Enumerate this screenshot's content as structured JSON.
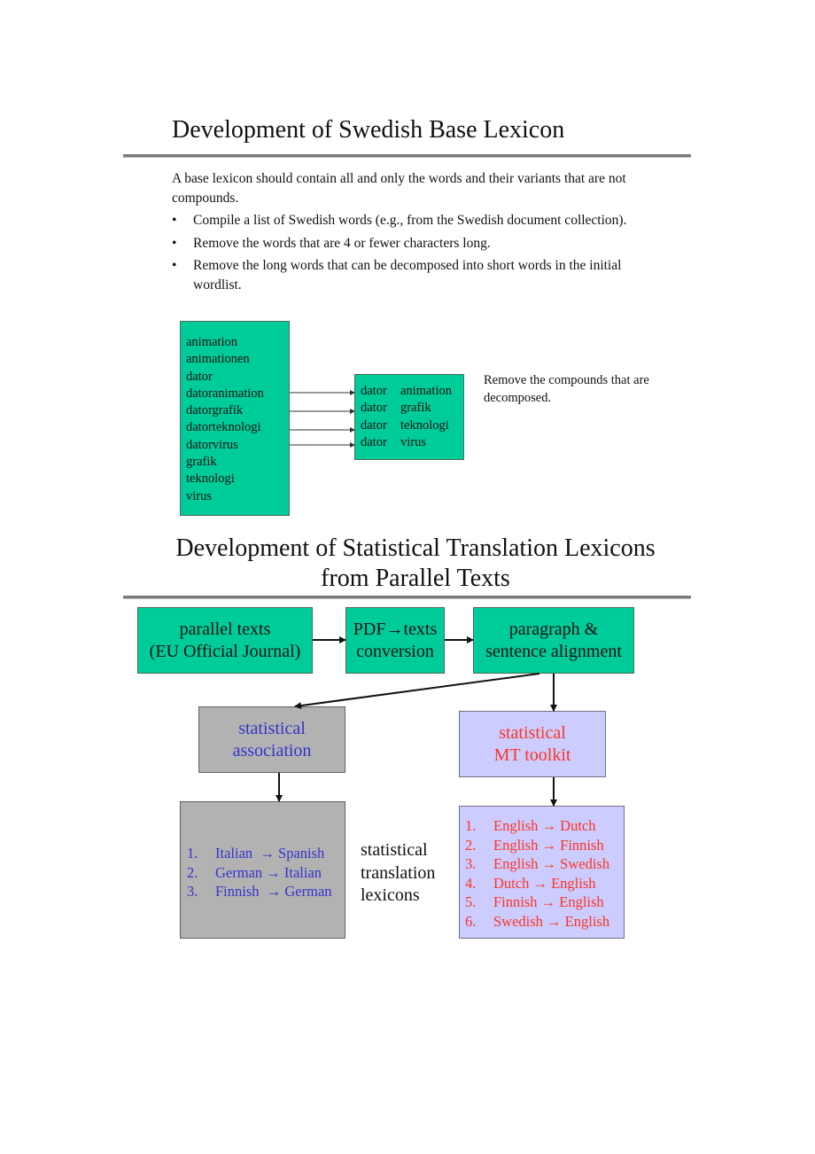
{
  "section1": {
    "title": "Development of Swedish Base Lexicon",
    "intro": "A base lexicon should contain all and only the words and their variants that are not compounds.",
    "bullet_glyph": "•",
    "bullets": [
      "Compile a list of Swedish words (e.g., from the Swedish document collection).",
      "Remove the words that are 4 or fewer characters long.",
      "Remove the long words that can be decomposed into short words in the initial wordlist."
    ],
    "wordlist": [
      "animation",
      "animationen",
      "dator",
      "datoranimation",
      "datorgrafik",
      "datorteknologi",
      "datorvirus",
      "grafik",
      "teknologi",
      "virus"
    ],
    "decomposed": [
      {
        "first": "dator",
        "second": "animation"
      },
      {
        "first": "dator",
        "second": "grafik"
      },
      {
        "first": "dator",
        "second": "teknologi"
      },
      {
        "first": "dator",
        "second": "virus"
      }
    ],
    "note": "Remove the compounds that are decomposed."
  },
  "section2": {
    "title_line1": "Development of Statistical Translation Lexicons",
    "title_line2": "from Parallel Texts",
    "pipeline": [
      {
        "line1": "parallel texts",
        "line2": "(EU Official Journal)"
      },
      {
        "line1": "PDF→texts",
        "line2": "conversion"
      },
      {
        "line1": "paragraph &",
        "line2": "sentence alignment"
      }
    ],
    "association": {
      "line1": "statistical",
      "line2": "association"
    },
    "toolkit": {
      "line1": "statistical",
      "line2": "MT toolkit"
    },
    "association_pairs": [
      {
        "num": "1.",
        "pair": "Italian  → Spanish"
      },
      {
        "num": "2.",
        "pair": "German → Italian"
      },
      {
        "num": "3.",
        "pair": "Finnish  → German"
      }
    ],
    "toolkit_pairs": [
      {
        "num": "1.",
        "pair": "English → Dutch"
      },
      {
        "num": "2.",
        "pair": "English → Finnish"
      },
      {
        "num": "3.",
        "pair": "English → Swedish"
      },
      {
        "num": "4.",
        "pair": "Dutch → English"
      },
      {
        "num": "5.",
        "pair": "Finnish → English"
      },
      {
        "num": "6.",
        "pair": "Swedish → English"
      }
    ],
    "side_label": [
      "statistical",
      "translation",
      "lexicons"
    ]
  },
  "colors": {
    "green_box": "#00cc99",
    "gray_box": "#b2b2b2",
    "lavender_box": "#ccccff",
    "blue_text": "#3333cc",
    "red_text": "#ff3322",
    "rule": "#7a7a7a"
  }
}
